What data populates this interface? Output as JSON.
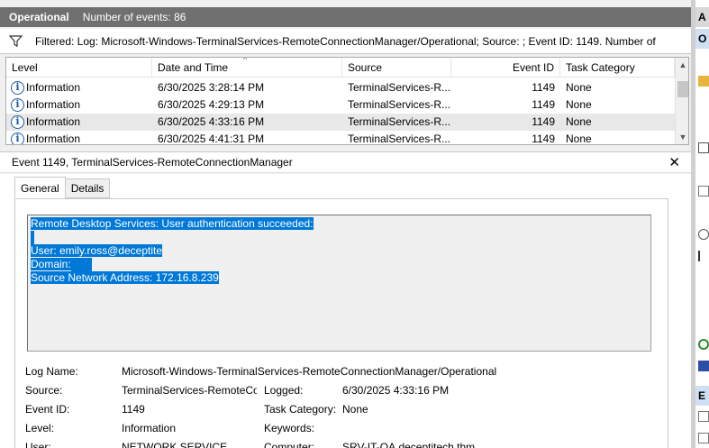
{
  "header": {
    "title": "Operational",
    "count_label": "Number of events: 86"
  },
  "filter": {
    "text": "Filtered: Log: Microsoft-Windows-TerminalServices-RemoteConnectionManager/Operational; Source: ; Event ID: 1149. Number of"
  },
  "grid": {
    "columns": [
      "Level",
      "Date and Time",
      "Source",
      "Event ID",
      "Task Category"
    ],
    "rows": [
      {
        "level": "Information",
        "datetime": "6/30/2025 3:28:14 PM",
        "source": "TerminalServices-R...",
        "event_id": "1149",
        "category": "None"
      },
      {
        "level": "Information",
        "datetime": "6/30/2025 4:29:13 PM",
        "source": "TerminalServices-R...",
        "event_id": "1149",
        "category": "None"
      },
      {
        "level": "Information",
        "datetime": "6/30/2025 4:33:16 PM",
        "source": "TerminalServices-R...",
        "event_id": "1149",
        "category": "None"
      },
      {
        "level": "Information",
        "datetime": "6/30/2025 4:41:31 PM",
        "source": "TerminalServices-R...",
        "event_id": "1149",
        "category": "None"
      }
    ]
  },
  "detail": {
    "title": "Event 1149, TerminalServices-RemoteConnectionManager",
    "close_glyph": "✕",
    "tabs": [
      "General",
      "Details"
    ],
    "message_lines": [
      "Remote Desktop Services: User authentication succeeded:",
      "",
      "User: emily.ross@deceptite",
      "Domain:",
      "Source Network Address: 172.16.8.239"
    ],
    "props": {
      "log_name_label": "Log Name:",
      "log_name_value": "Microsoft-Windows-TerminalServices-RemoteConnectionManager/Operational",
      "source_label": "Source:",
      "source_value": "TerminalServices-RemoteCo",
      "logged_label": "Logged:",
      "logged_value": "6/30/2025 4:33:16 PM",
      "event_id_label": "Event ID:",
      "event_id_value": "1149",
      "task_category_label": "Task Category:",
      "task_category_value": "None",
      "level_label": "Level:",
      "level_value": "Information",
      "keywords_label": "Keywords:",
      "user_label": "User:",
      "user_value": "NETWORK SERVICE",
      "computer_label": "Computer:",
      "computer_value": "SRV-IT-QA.deceptitech.thm"
    }
  },
  "actions_pane": {
    "header_initial": "A",
    "section_initial_1": "O",
    "section_initial_2": "E"
  },
  "colors": {
    "title_bar": "#707070",
    "selection": "#0078d7",
    "info_icon": "#1e5aa8"
  }
}
